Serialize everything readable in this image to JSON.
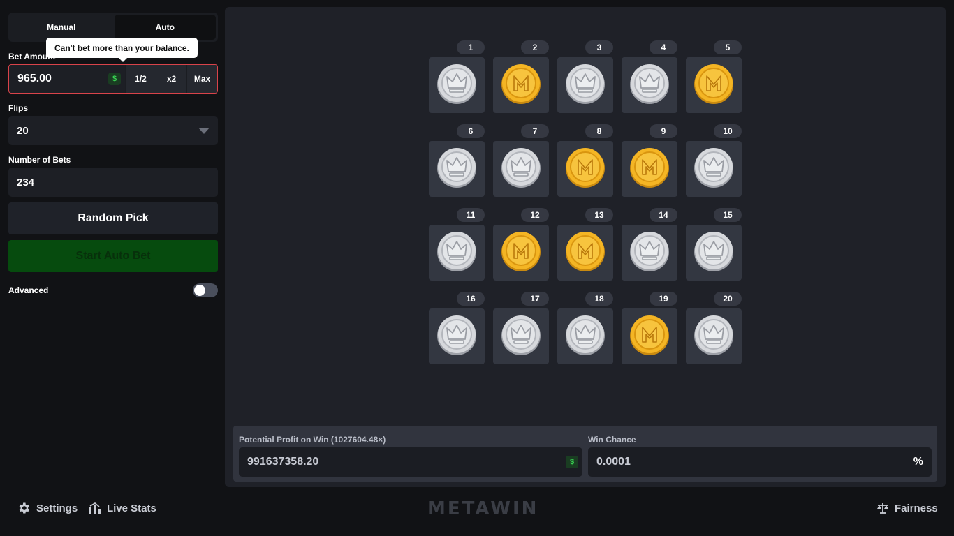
{
  "tabs": [
    {
      "label": "Manual",
      "active": false
    },
    {
      "label": "Auto",
      "active": true
    }
  ],
  "tooltip": "Can't bet more than your balance.",
  "bet": {
    "label": "Bet Amount",
    "value": "965.00",
    "currency_symbol": "$",
    "half_label": "1/2",
    "double_label": "x2",
    "max_label": "Max"
  },
  "flips": {
    "label": "Flips",
    "value": "20"
  },
  "num_bets": {
    "label": "Number of Bets",
    "value": "234"
  },
  "random_pick_label": "Random Pick",
  "start_auto_label": "Start Auto Bet",
  "advanced": {
    "label": "Advanced",
    "enabled": false
  },
  "coins": [
    {
      "num": "1",
      "face": "silver"
    },
    {
      "num": "2",
      "face": "gold"
    },
    {
      "num": "3",
      "face": "silver"
    },
    {
      "num": "4",
      "face": "silver"
    },
    {
      "num": "5",
      "face": "gold"
    },
    {
      "num": "6",
      "face": "silver"
    },
    {
      "num": "7",
      "face": "silver"
    },
    {
      "num": "8",
      "face": "gold"
    },
    {
      "num": "9",
      "face": "gold"
    },
    {
      "num": "10",
      "face": "silver"
    },
    {
      "num": "11",
      "face": "silver"
    },
    {
      "num": "12",
      "face": "gold"
    },
    {
      "num": "13",
      "face": "gold"
    },
    {
      "num": "14",
      "face": "silver"
    },
    {
      "num": "15",
      "face": "silver"
    },
    {
      "num": "16",
      "face": "silver"
    },
    {
      "num": "17",
      "face": "silver"
    },
    {
      "num": "18",
      "face": "silver"
    },
    {
      "num": "19",
      "face": "gold"
    },
    {
      "num": "20",
      "face": "silver"
    }
  ],
  "profit": {
    "label": "Potential Profit on Win (1027604.48×)",
    "value": "991637358.20",
    "currency_symbol": "$"
  },
  "win_chance": {
    "label": "Win Chance",
    "value": "0.0001",
    "unit": "%"
  },
  "footer": {
    "settings_label": "Settings",
    "live_stats_label": "Live Stats",
    "brand": "METAWIN",
    "fairness_label": "Fairness"
  },
  "colors": {
    "accent_green": "#39d353",
    "error_border": "#d9434a",
    "gold_coin": "#f2b21d",
    "silver_coin": "#d4d6da"
  }
}
